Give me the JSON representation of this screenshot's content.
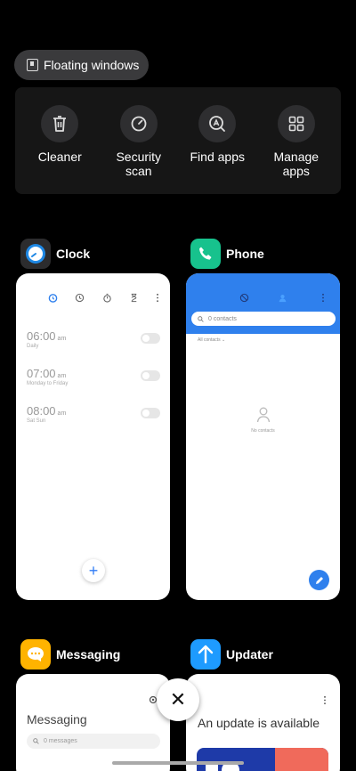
{
  "floating_windows": {
    "label": "Floating windows",
    "icon": "floating-window-icon"
  },
  "tools": [
    {
      "label": "Cleaner",
      "icon": "trash-icon"
    },
    {
      "label": "Security scan",
      "icon": "security-gauge-icon"
    },
    {
      "label": "Find apps",
      "icon": "find-apps-icon"
    },
    {
      "label": "Manage apps",
      "icon": "grid-icon"
    }
  ],
  "apps": {
    "clock": {
      "title": "Clock",
      "alarms": [
        {
          "time": "06:00",
          "ampm": "am",
          "repeat": "Daily"
        },
        {
          "time": "07:00",
          "ampm": "am",
          "repeat": "Monday to Friday"
        },
        {
          "time": "08:00",
          "ampm": "am",
          "repeat": "Sat Sun"
        }
      ],
      "add_symbol": "+"
    },
    "phone": {
      "title": "Phone",
      "search_placeholder": "0 contacts",
      "filter": "All contacts",
      "empty_text": "No contacts"
    },
    "messaging": {
      "title": "Messaging",
      "heading": "Messaging",
      "search_placeholder": "0 messages"
    },
    "updater": {
      "title": "Updater",
      "heading": "An update is available"
    }
  },
  "close_symbol": "✕",
  "colors": {
    "accent_blue": "#2f80ed",
    "phone_green": "#17c28d",
    "messaging_orange": "#ffb300",
    "updater_blue": "#1e9bff"
  }
}
